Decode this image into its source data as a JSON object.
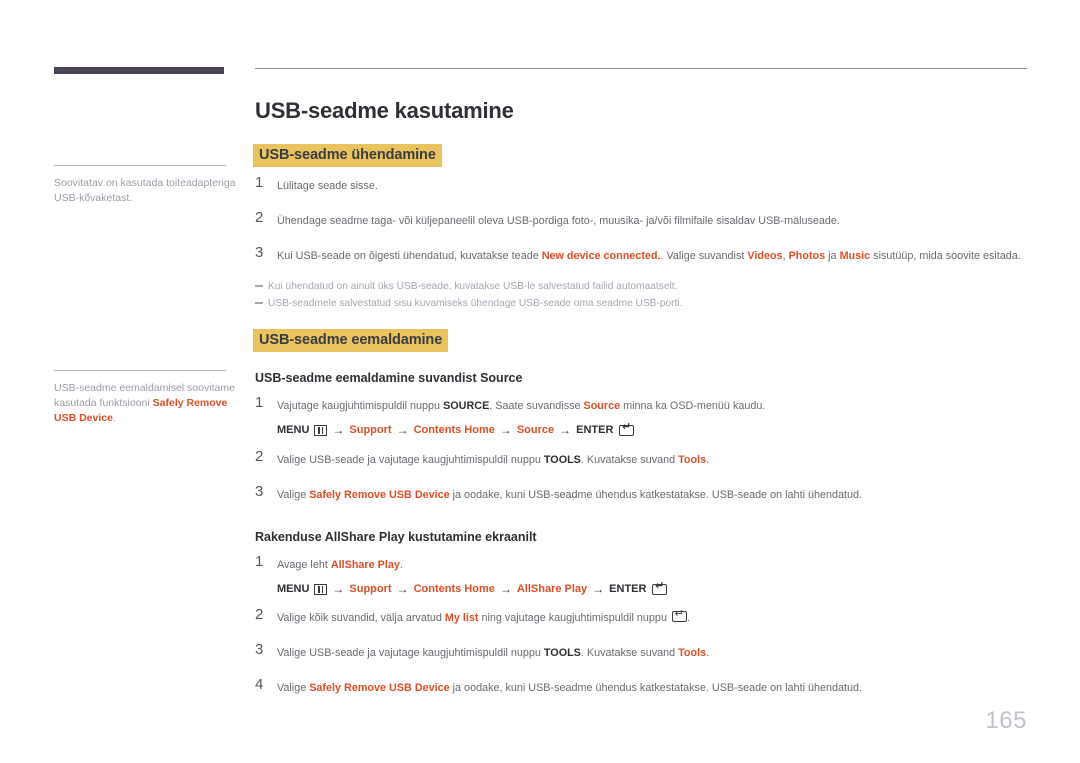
{
  "colors": {
    "rail_bar": "#4a4255",
    "highlight": "#e9c35e",
    "accent": "#dd4f26",
    "body_text": "#6a6a72",
    "strong_text": "#2f2f35",
    "tip_text": "#a6a6b2"
  },
  "page_number": "165",
  "document": {
    "title": "USB-seadme kasutamine"
  },
  "sidebar": {
    "notes": [
      {
        "id": "note-power-adapter",
        "text_parts": [
          {
            "text": "Soovitatav on kasutada toiteadapteriga USB-kõvaketast.",
            "style": "plain"
          }
        ],
        "plain_text": "Soovitatav on kasutada toiteadapteriga USB-kõvaketast."
      },
      {
        "id": "note-safely-remove",
        "text_parts": [
          {
            "text": "USB-seadme eemaldamisel soovitame kasutada funktsiooni ",
            "style": "plain"
          },
          {
            "text": "Safely Remove USB Device",
            "style": "accent"
          },
          {
            "text": ".",
            "style": "plain"
          }
        ],
        "plain_text": "USB-seadme eemaldamisel soovitame kasutada funktsiooni Safely Remove USB Device."
      }
    ]
  },
  "sections": [
    {
      "id": "section-connecting",
      "heading": "USB-seadme ühendamine",
      "steps": [
        {
          "number": "1",
          "parts": [
            {
              "text": "Lülitage seade sisse.",
              "style": "plain"
            }
          ]
        },
        {
          "number": "2",
          "parts": [
            {
              "text": "Ühendage seadme taga- või küljepaneelil oleva USB-pordiga foto-, muusika- ja/või filmifaile sisaldav USB-mäluseade.",
              "style": "plain"
            }
          ]
        },
        {
          "number": "3",
          "parts": [
            {
              "text": "Kui USB-seade on õigesti ühendatud, kuvatakse teade ",
              "style": "plain"
            },
            {
              "text": "New device connected.",
              "style": "accent"
            },
            {
              "text": ". Valige suvandist ",
              "style": "plain"
            },
            {
              "text": "Videos",
              "style": "accent"
            },
            {
              "text": ", ",
              "style": "plain"
            },
            {
              "text": "Photos",
              "style": "accent"
            },
            {
              "text": " ja ",
              "style": "plain"
            },
            {
              "text": "Music",
              "style": "accent"
            },
            {
              "text": " sisutüüp, mida soovite esitada.",
              "style": "plain"
            }
          ]
        }
      ],
      "tips": [
        "Kui ühendatud on ainult üks USB-seade, kuvatakse USB-le salvestatud failid automaatselt.",
        "USB-seadmele salvestatud sisu kuvamiseks ühendage USB-seade oma seadme USB-porti."
      ]
    },
    {
      "id": "section-removing",
      "heading": "USB-seadme eemaldamine",
      "subsections": [
        {
          "id": "subsection-source",
          "heading": "USB-seadme eemaldamine suvandist Source",
          "steps": [
            {
              "number": "1",
              "parts": [
                {
                  "text": "Vajutage kaugjuhtimispuldil nuppu ",
                  "style": "plain"
                },
                {
                  "text": "SOURCE",
                  "style": "strong"
                },
                {
                  "text": ". Saate suvandisse ",
                  "style": "plain"
                },
                {
                  "text": "Source",
                  "style": "accent"
                },
                {
                  "text": " minna ka OSD-menüü kaudu.",
                  "style": "plain"
                }
              ],
              "menu_path": {
                "items": [
                  {
                    "label": "MENU",
                    "style": "strong",
                    "icon": "menu-icon"
                  },
                  {
                    "label": "Support",
                    "style": "accent"
                  },
                  {
                    "label": "Contents Home",
                    "style": "accent"
                  },
                  {
                    "label": "Source",
                    "style": "accent"
                  },
                  {
                    "label": "ENTER",
                    "style": "strong",
                    "icon": "enter-icon"
                  }
                ],
                "separator": "→"
              }
            },
            {
              "number": "2",
              "parts": [
                {
                  "text": "Valige USB-seade ja vajutage kaugjuhtimispuldil nuppu ",
                  "style": "plain"
                },
                {
                  "text": "TOOLS",
                  "style": "strong"
                },
                {
                  "text": ". Kuvatakse suvand ",
                  "style": "plain"
                },
                {
                  "text": "Tools",
                  "style": "accent"
                },
                {
                  "text": ".",
                  "style": "plain"
                }
              ]
            },
            {
              "number": "3",
              "parts": [
                {
                  "text": "Valige ",
                  "style": "plain"
                },
                {
                  "text": "Safely Remove USB Device",
                  "style": "accent"
                },
                {
                  "text": " ja oodake, kuni USB-seadme ühendus katkestatakse. USB-seade on lahti ühendatud.",
                  "style": "plain"
                }
              ]
            }
          ]
        },
        {
          "id": "subsection-allshare",
          "heading": "Rakenduse AllShare Play kustutamine ekraanilt",
          "steps": [
            {
              "number": "1",
              "parts": [
                {
                  "text": "Avage leht ",
                  "style": "plain"
                },
                {
                  "text": "AllShare Play",
                  "style": "accent"
                },
                {
                  "text": ".",
                  "style": "plain"
                }
              ],
              "menu_path": {
                "items": [
                  {
                    "label": "MENU",
                    "style": "strong",
                    "icon": "menu-icon"
                  },
                  {
                    "label": "Support",
                    "style": "accent"
                  },
                  {
                    "label": "Contents Home",
                    "style": "accent"
                  },
                  {
                    "label": "AllShare Play",
                    "style": "accent"
                  },
                  {
                    "label": "ENTER",
                    "style": "strong",
                    "icon": "enter-icon"
                  }
                ],
                "separator": "→"
              }
            },
            {
              "number": "2",
              "parts": [
                {
                  "text": "Valige kõik suvandid, välja arvatud ",
                  "style": "plain"
                },
                {
                  "text": "My list",
                  "style": "accent"
                },
                {
                  "text": " ning vajutage kaugjuhtimispuldil nuppu ",
                  "style": "plain"
                },
                {
                  "text": "",
                  "style": "enter-icon"
                },
                {
                  "text": ".",
                  "style": "plain"
                }
              ]
            },
            {
              "number": "3",
              "parts": [
                {
                  "text": "Valige USB-seade ja vajutage kaugjuhtimispuldil nuppu ",
                  "style": "plain"
                },
                {
                  "text": "TOOLS",
                  "style": "strong"
                },
                {
                  "text": ". Kuvatakse suvand ",
                  "style": "plain"
                },
                {
                  "text": "Tools",
                  "style": "accent"
                },
                {
                  "text": ".",
                  "style": "plain"
                }
              ]
            },
            {
              "number": "4",
              "parts": [
                {
                  "text": "Valige ",
                  "style": "plain"
                },
                {
                  "text": "Safely Remove USB Device",
                  "style": "accent"
                },
                {
                  "text": " ja oodake, kuni USB-seadme ühendus katkestatakse. USB-seade on lahti ühendatud.",
                  "style": "plain"
                }
              ]
            }
          ]
        }
      ]
    }
  ],
  "step_positions": {
    "s1_1": 178,
    "s1_2": 213,
    "s1_3": 248,
    "s2_1": 398,
    "s2_2": 452,
    "s2_3": 487,
    "s3_1": 557,
    "s3_2": 610,
    "s3_3": 645,
    "s3_4": 680
  }
}
